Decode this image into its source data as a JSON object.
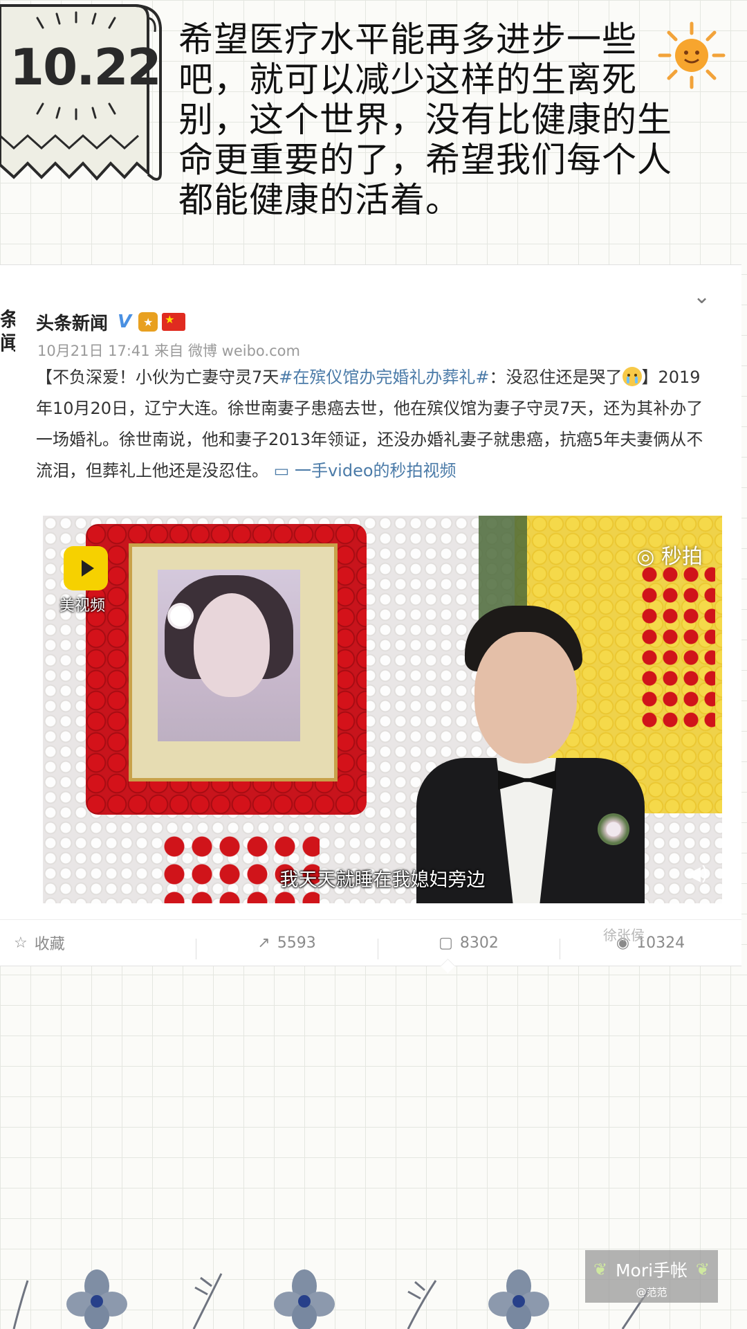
{
  "header": {
    "date": "10.22",
    "text": "希望医疗水平能再多进步一些吧，就可以减少这样的生离死别，这个世界，没有比健康的生命更重要的了，希望我们每个人都能健康的活着。"
  },
  "post": {
    "left_clip": "条闻",
    "username": "头条新闻",
    "verified": "V",
    "meta": "10月21日 17:41 来自 微博 weibo.com",
    "text_lead": "【不负深爱！小伙为亡妻守灵7天",
    "hashtag": "#在殡仪馆办完婚礼办葬礼#",
    "text_mid": "：没忍住还是哭了",
    "text_main": "】2019年10月20日，辽宁大连。徐世南妻子患癌去世，他在殡仪馆为妻子守灵7天，还为其补办了一场婚礼。徐世南说，他和妻子2013年领证，还没办婚礼妻子就患癌，抗癌5年夫妻俩从不流泪，但葬礼上他还是没忍住。",
    "video_link": "一手video的秒拍视频"
  },
  "video": {
    "meipai_label": "美视频",
    "miaopai_label": "秒拍",
    "subtitle": "我天天就睡在我媳妇旁边"
  },
  "actions": {
    "collect_label": "收藏",
    "repost_count": "5593",
    "comment_count": "8302",
    "like_count": "10324",
    "watermark": "徐张侯"
  },
  "brand": {
    "title": "Mori手帐",
    "sub": "@范范"
  },
  "colors": {
    "link": "#4b7ba8",
    "background_grid": "#e4e6e0"
  }
}
